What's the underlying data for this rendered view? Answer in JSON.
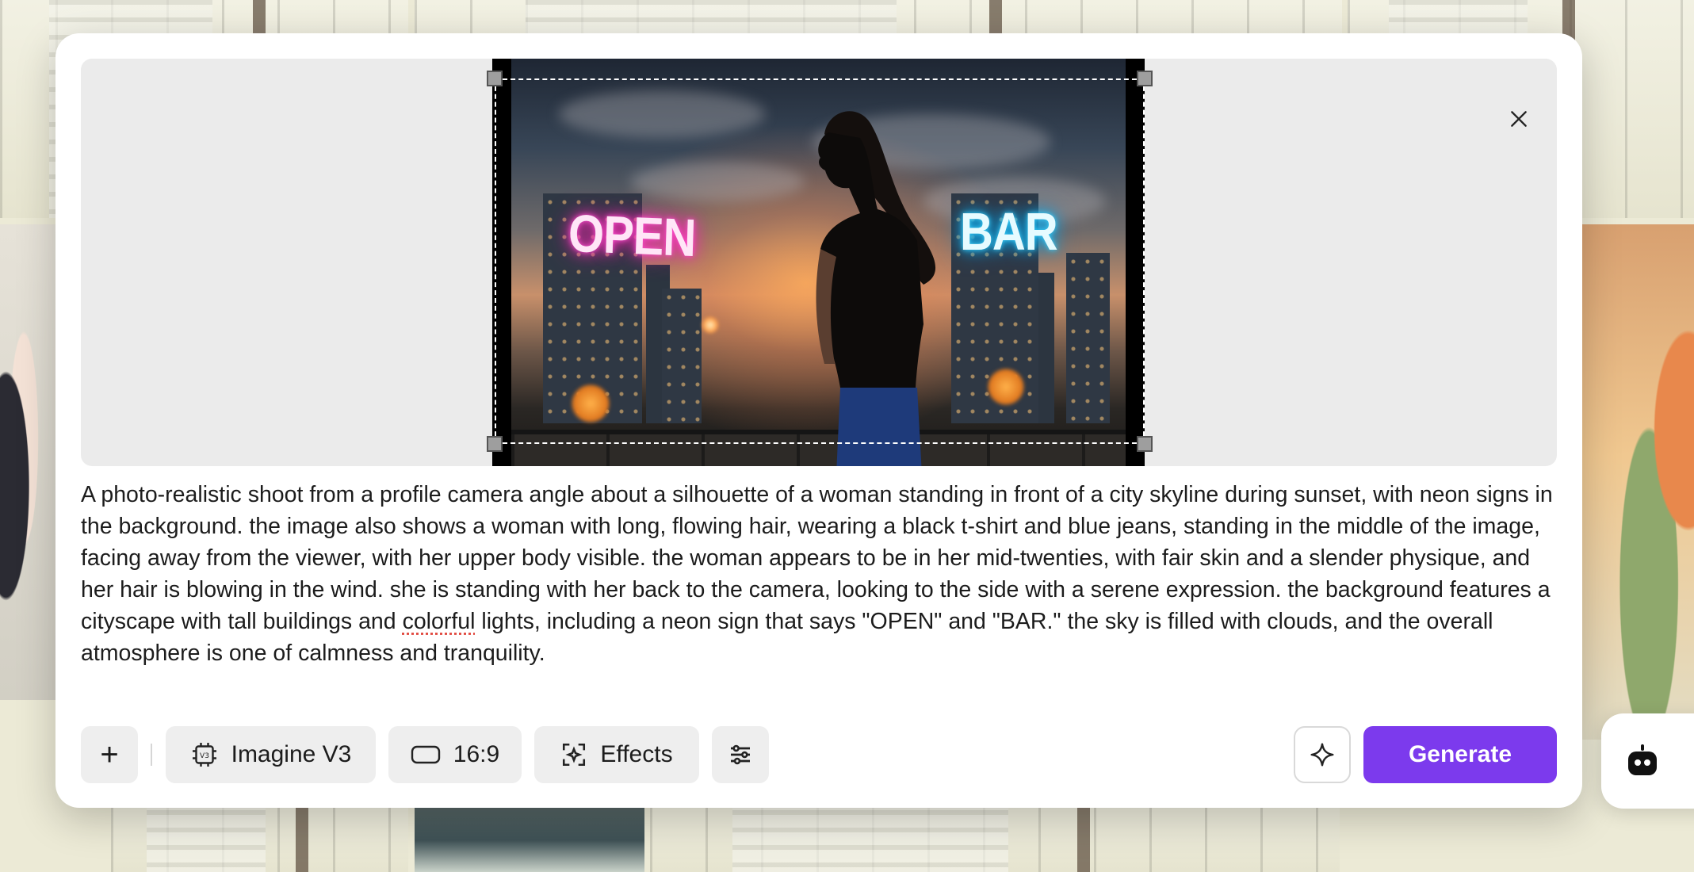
{
  "prompt": {
    "text_before": "A photo-realistic shoot from a profile camera angle about a silhouette of a woman standing in front of a city skyline during sunset, with neon signs in the background. the image also shows a woman with long, flowing hair, wearing a black t-shirt and blue jeans, standing in the middle of the image, facing away from the viewer, with her upper body visible. the woman appears to be in her mid-twenties, with fair skin and a slender physique, and her hair is blowing in the wind. she is standing with her back to the camera, looking to the side with a serene expression. the background features a cityscape with tall buildings and ",
    "misspelled_word": "colorful",
    "text_after": " lights, including a neon sign that says \"OPEN\" and \"BAR.\" the sky is filled with clouds, and the overall atmosphere is one of calmness and tranquility."
  },
  "preview": {
    "neon_sign_left": "OPEN",
    "neon_sign_right": "BAR"
  },
  "toolbar": {
    "add_label": "+",
    "model_label": "Imagine V3",
    "model_icon": "chip-v3-icon",
    "aspect_ratio_label": "16:9",
    "aspect_icon": "aspect-ratio-icon",
    "effects_label": "Effects",
    "effects_icon": "effects-focus-icon",
    "settings_icon": "sliders-icon",
    "enhance_icon": "sparkle-icon",
    "generate_label": "Generate"
  },
  "colors": {
    "accent": "#7c3aed",
    "button_bg": "#eeeeee",
    "preview_bg": "#ebebeb"
  }
}
